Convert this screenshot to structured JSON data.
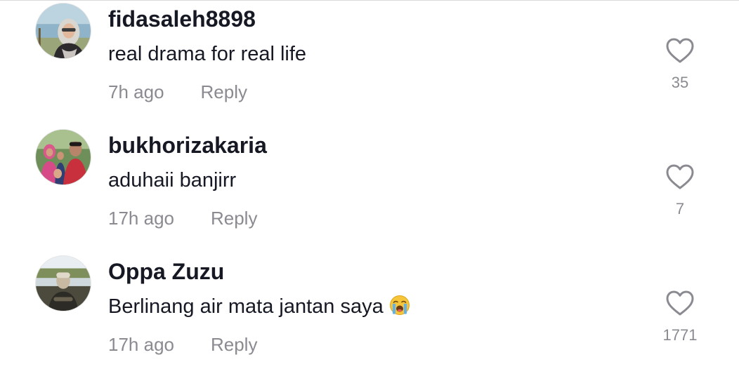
{
  "comments": [
    {
      "username": "fidasaleh8898",
      "text": "real drama for real life",
      "time": "7h ago",
      "reply_label": "Reply",
      "likes": "35",
      "avatar_icon": "user-photo-icon"
    },
    {
      "username": "bukhorizakaria",
      "text": "aduhaii banjirr",
      "time": "17h ago",
      "reply_label": "Reply",
      "likes": "7",
      "avatar_icon": "user-photo-icon"
    },
    {
      "username": "Oppa Zuzu",
      "text": "Berlinang air mata jantan saya",
      "emoji": "loudly-crying-face-emoji",
      "time": "17h ago",
      "reply_label": "Reply",
      "likes": "1771",
      "avatar_icon": "user-photo-icon"
    }
  ],
  "colors": {
    "primary_text": "#161823",
    "secondary_text": "#8a8b91",
    "heart_outline": "#8a8b91"
  }
}
